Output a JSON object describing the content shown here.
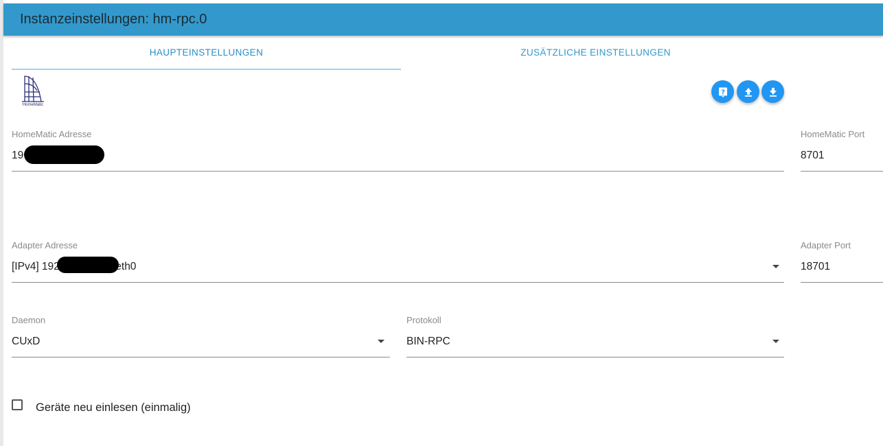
{
  "header": {
    "title": "Instanzeinstellungen: hm-rpc.0"
  },
  "tabs": [
    {
      "label": "HAUPTEINSTELLUNGEN",
      "active": true
    },
    {
      "label": "ZUSÄTZLICHE EINSTELLUNGEN",
      "active": false
    }
  ],
  "logo": {
    "text": "HomeMatic"
  },
  "toolbar": {
    "help_icon": "help-icon",
    "upload_icon": "upload-icon",
    "download_icon": "download-icon"
  },
  "fields": {
    "homematic_address": {
      "label": "HomeMatic Adresse",
      "value": "19"
    },
    "homematic_port": {
      "label": "HomeMatic Port",
      "value": "8701"
    },
    "adapter_address": {
      "label": "Adapter Adresse",
      "value_prefix": "[IPv4] 192",
      "value_suffix": "- eth0"
    },
    "adapter_port": {
      "label": "Adapter Port",
      "value": "18701"
    },
    "daemon": {
      "label": "Daemon",
      "value": "CUxD"
    },
    "protocol": {
      "label": "Protokoll",
      "value": "BIN-RPC"
    }
  },
  "checkbox": {
    "label": "Geräte neu einlesen (einmalig)",
    "checked": false
  },
  "colors": {
    "header": "#3399cc",
    "accent": "#2196f3",
    "tab_text": "#3399cc"
  }
}
